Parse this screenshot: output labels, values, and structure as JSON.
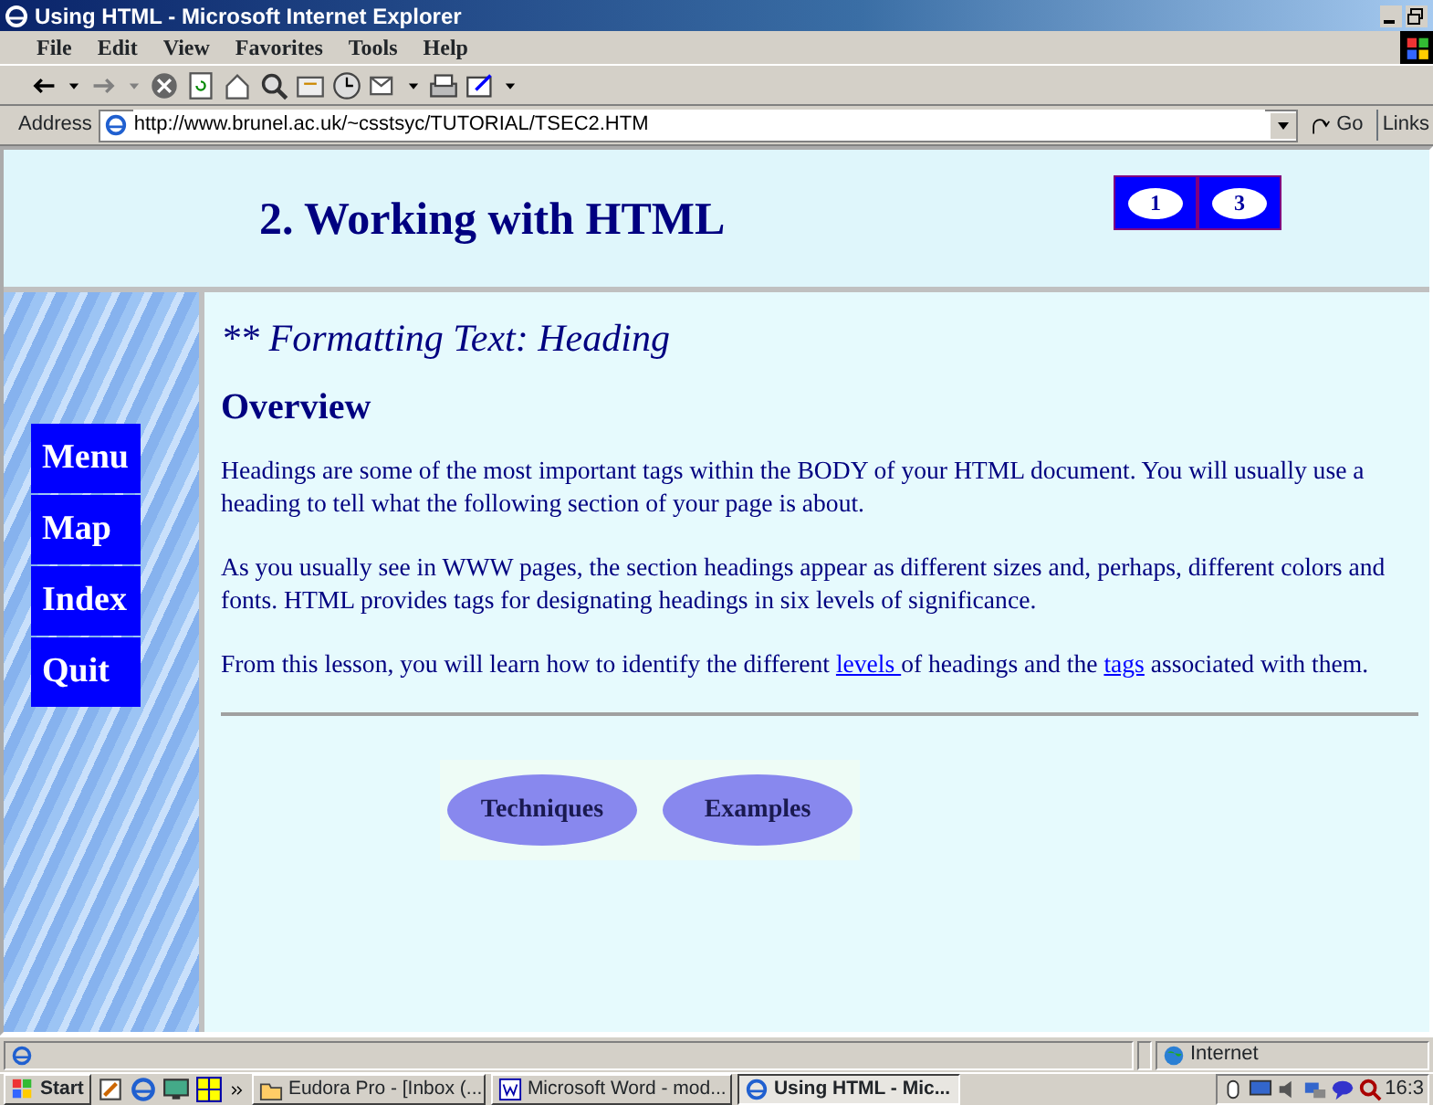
{
  "window": {
    "title": "Using HTML - Microsoft Internet Explorer"
  },
  "menu": [
    "File",
    "Edit",
    "View",
    "Favorites",
    "Tools",
    "Help"
  ],
  "address_bar": {
    "label": "Address",
    "value": "http://www.brunel.ac.uk/~csstsyc/TUTORIAL/TSEC2.HTM",
    "go": "Go",
    "links": "Links"
  },
  "page": {
    "title": "2. Working with HTML",
    "page_buttons": [
      "1",
      "3"
    ],
    "nav": [
      "Menu",
      "Map",
      "Index",
      "Quit"
    ],
    "section_title": "** Formatting Text: Heading",
    "heading": "Overview",
    "paragraphs": [
      [
        {
          "text": "Headings are some of the most important tags within the BODY of your HTML document. You will usually use a heading to tell what the following section of your page is about."
        }
      ],
      [
        {
          "text": "As you usually see in WWW pages, the section headings appear as different sizes and, perhaps, different colors and fonts. HTML provides tags for designating headings in six levels of significance."
        }
      ],
      [
        {
          "text": "From this lesson, you will learn how to identify the different "
        },
        {
          "text": "levels ",
          "link": true
        },
        {
          "text": "of headings and the "
        },
        {
          "text": "tags",
          "link": true
        },
        {
          "text": " associated with them."
        }
      ]
    ],
    "buttons": [
      "Techniques",
      "Examples"
    ]
  },
  "status_bar": {
    "zone": "Internet"
  },
  "taskbar": {
    "start": "Start",
    "tasks": [
      {
        "label": "Eudora Pro - [Inbox (...",
        "selected": false
      },
      {
        "label": "Microsoft Word - mod...",
        "selected": false
      },
      {
        "label": "Using HTML - Mic...",
        "selected": true
      }
    ],
    "clock": "16:3"
  }
}
